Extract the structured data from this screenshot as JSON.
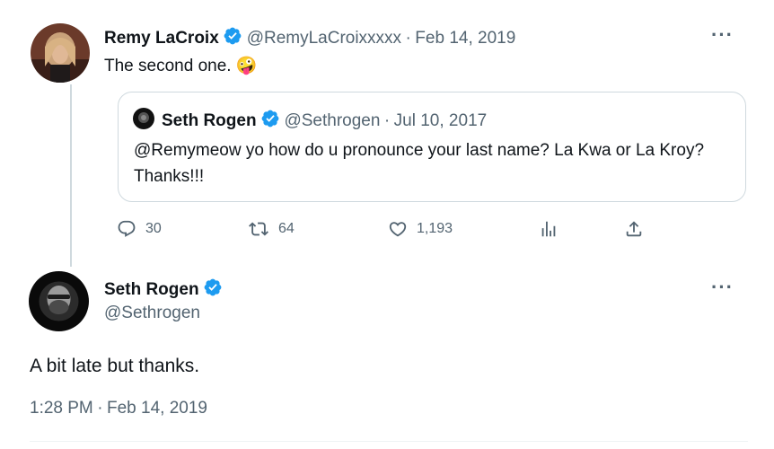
{
  "colors": {
    "text": "#0f1419",
    "muted": "#536471",
    "verified": "#1d9bf0",
    "border": "#cfd9de"
  },
  "reply_tweet": {
    "author_name": "Remy LaCroix",
    "handle": "@RemyLaCroixxxxx",
    "separator": "·",
    "date": "Feb 14, 2019",
    "text": "The second one.",
    "emoji": "🤪",
    "more_icon": "more-horizontal-icon",
    "quoted": {
      "author_name": "Seth Rogen",
      "handle": "@Sethrogen",
      "separator": "·",
      "date": "Jul 10, 2017",
      "text": "@Remymeow yo how do u pronounce your last name? La Kwa or La Kroy? Thanks!!!"
    },
    "actions": {
      "reply_count": "30",
      "retweet_count": "64",
      "like_count": "1,193",
      "views_icon": "analytics-icon",
      "share_icon": "share-icon"
    }
  },
  "main_tweet": {
    "author_name": "Seth Rogen",
    "handle": "@Sethrogen",
    "text": "A bit late but thanks.",
    "time": "1:28 PM",
    "separator": "·",
    "date": "Feb 14, 2019",
    "more_icon": "more-horizontal-icon"
  }
}
